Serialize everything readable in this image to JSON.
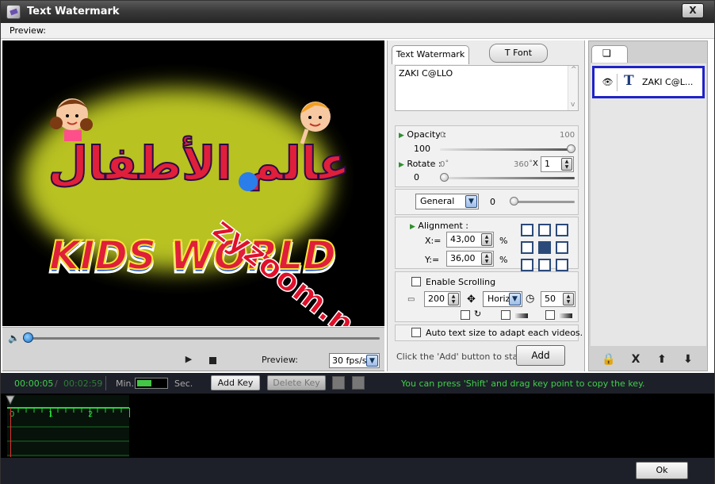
{
  "window": {
    "title": "Text Watermark",
    "close_label": "X"
  },
  "menu": {
    "preview": "Preview:"
  },
  "overlay": {
    "arabic_title": "عالم الأطفال",
    "logo_text": "KIDS WORLD",
    "site_watermark": "zyzoom.net",
    "colors": {
      "glow": "#f6ff3a",
      "kids": "#e01f3a",
      "logo_blue": "#1a53d6"
    }
  },
  "player": {
    "preview_label": "Preview:",
    "fps": "30 fps/s",
    "seek_fraction": 0.0
  },
  "text_panel": {
    "tab_text": "Text Watermark",
    "tab_font": "T Font",
    "text": "ZAKI C@LLO",
    "opacity": {
      "label": "Opacity :",
      "min": "0",
      "max": "100",
      "value": "100"
    },
    "rotate": {
      "label": "Rotate :",
      "min": "0˚",
      "max": "360˚",
      "multiplier_sign": "X",
      "multiplier": "1",
      "value": "0"
    },
    "effect": {
      "selected": "General",
      "value": "0"
    },
    "alignment": {
      "label": "Alignment :",
      "x_label": "X:=",
      "x_value": "43,00",
      "y_label": "Y:=",
      "y_value": "36,00",
      "unit": "%"
    },
    "scrolling": {
      "label": "Enable Scrolling",
      "speed": "200",
      "direction": "Horiz",
      "duration": "50"
    },
    "autosize_label": "Auto text size to adapt each videos.",
    "add_hint": "Click the 'Add' button to start ->",
    "add_label": "Add"
  },
  "layers": {
    "items": [
      {
        "name": "ZAKI C@L..."
      }
    ],
    "buttons": {
      "lock": "🔒",
      "delete": "X",
      "up": "⬆",
      "down": "⬇"
    }
  },
  "timeline": {
    "current": "00:00:05",
    "separator": "/",
    "total": "00:02:59",
    "min_label": "Min.",
    "sec_label": "Sec.",
    "add_key": "Add Key",
    "delete_key": "Delete Key",
    "shift_hint": "You can press 'Shift' and drag key point to copy the key.",
    "ruler": [
      "0",
      "1",
      "2"
    ]
  },
  "footer": {
    "ok": "Ok"
  }
}
